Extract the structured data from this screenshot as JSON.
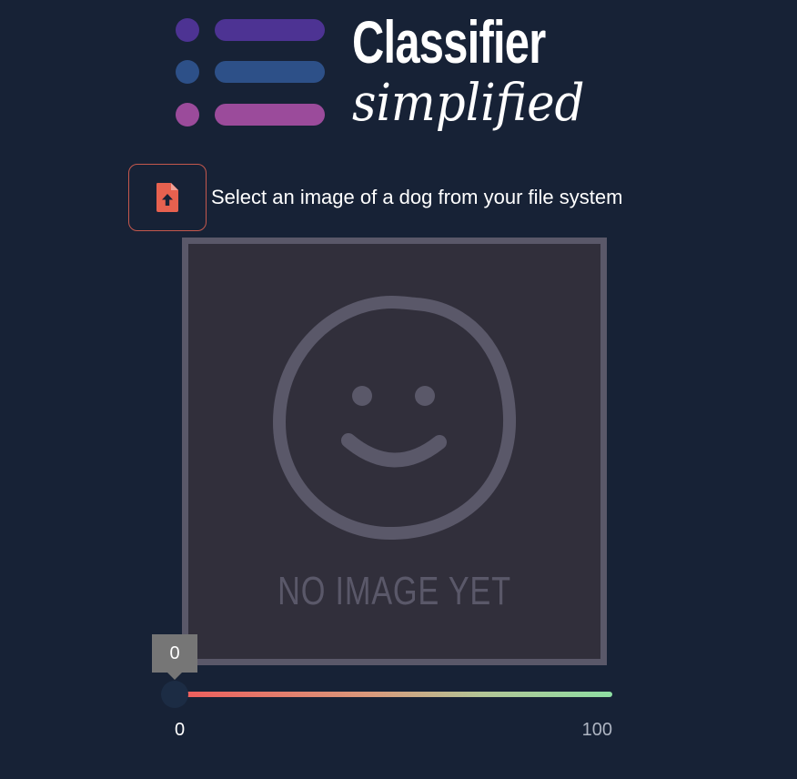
{
  "app": {
    "title": "Classifier",
    "subtitle": "simplified"
  },
  "logo": {
    "rows": [
      {
        "color": "#4d3393"
      },
      {
        "color": "#2d5088"
      },
      {
        "color": "#9b4b9b"
      }
    ],
    "bar_colors": [
      "#4d3393",
      "#2d5088",
      "#9b4b9b"
    ]
  },
  "upload": {
    "icon": "file-upload-icon",
    "label": "Select an image of a dog from your file system",
    "accent_color": "#e7614f"
  },
  "preview": {
    "icon": "smiley-face-icon",
    "placeholder_text": "NO IMAGE YET"
  },
  "confidence_slider": {
    "value": 0,
    "min": 0,
    "max": 100,
    "tooltip": "0",
    "min_label": "0",
    "max_label": "100",
    "gradient": [
      "#ef5b5b",
      "#8edfa3"
    ]
  }
}
